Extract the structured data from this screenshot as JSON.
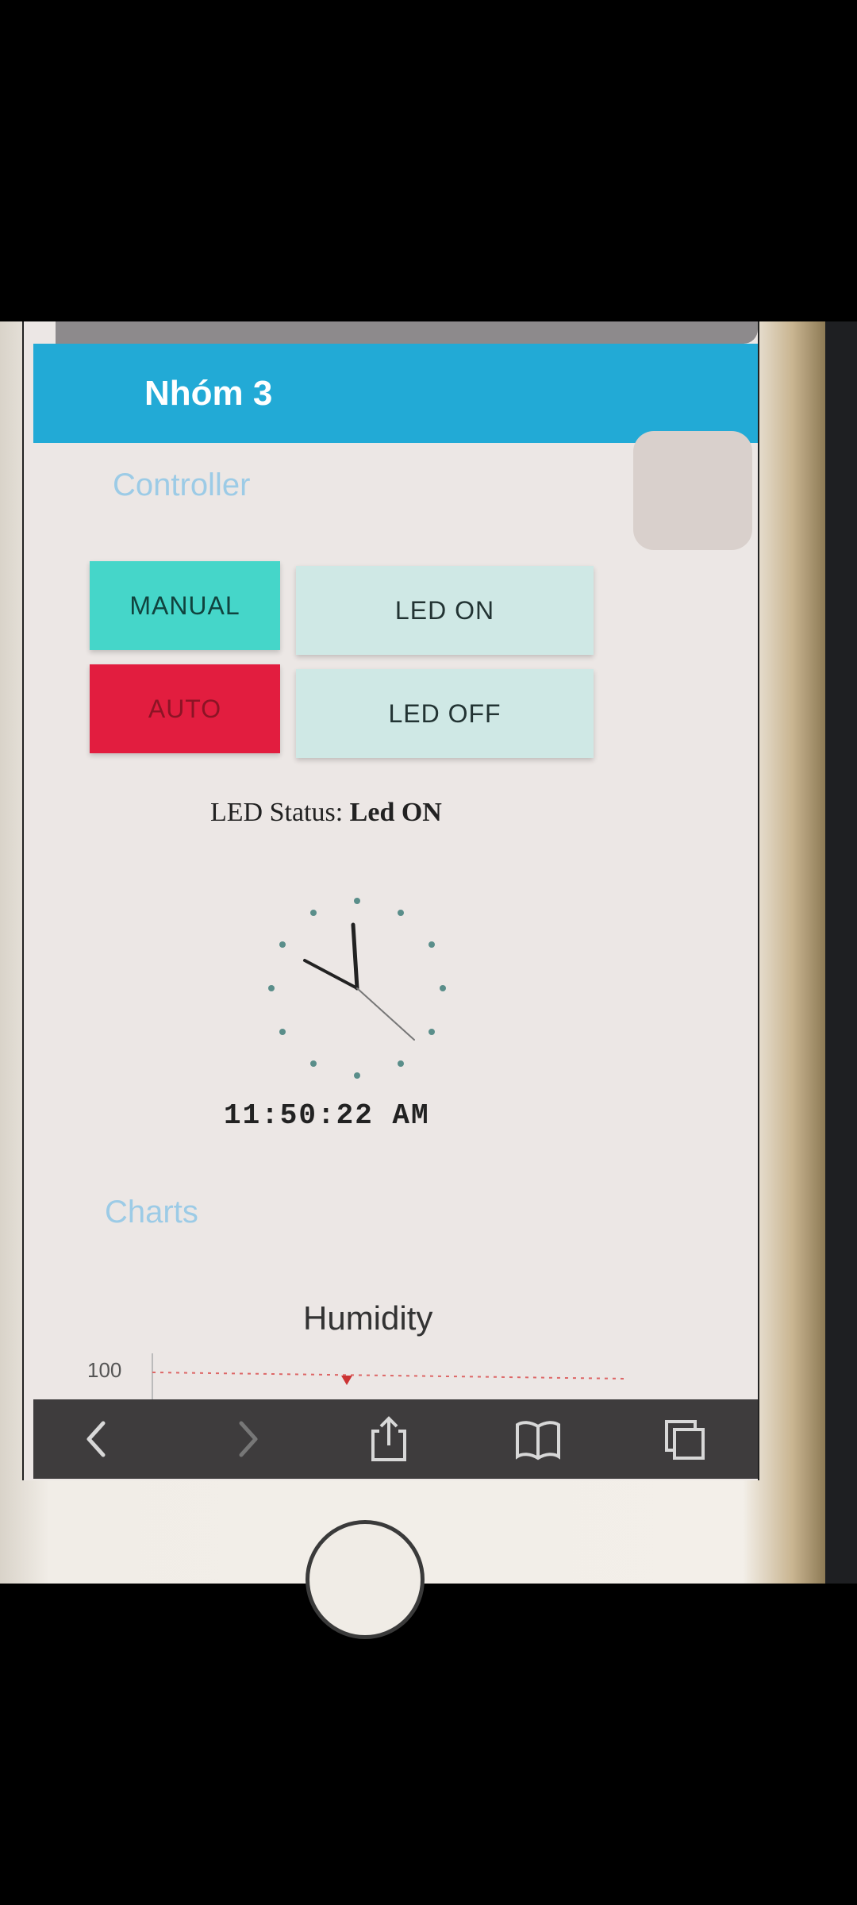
{
  "header": {
    "title": "Nhóm 3"
  },
  "controller": {
    "section_title": "Controller",
    "manual_label": "MANUAL",
    "auto_label": "AUTO",
    "led_on_label": "LED ON",
    "led_off_label": "LED OFF",
    "status_label": "LED Status:",
    "status_value": "Led ON",
    "time": "11:50:22 AM"
  },
  "charts": {
    "section_title": "Charts",
    "chart_data": {
      "type": "line",
      "title": "Humidity",
      "ytick_visible": "100"
    }
  },
  "toolbar": {
    "icons": [
      "back-icon",
      "forward-icon",
      "share-icon",
      "bookmarks-icon",
      "tabs-icon"
    ]
  },
  "colors": {
    "header": "#22aad6",
    "manual": "#45d6c9",
    "auto": "#e21d3f",
    "led_button": "#cfe8e5"
  }
}
